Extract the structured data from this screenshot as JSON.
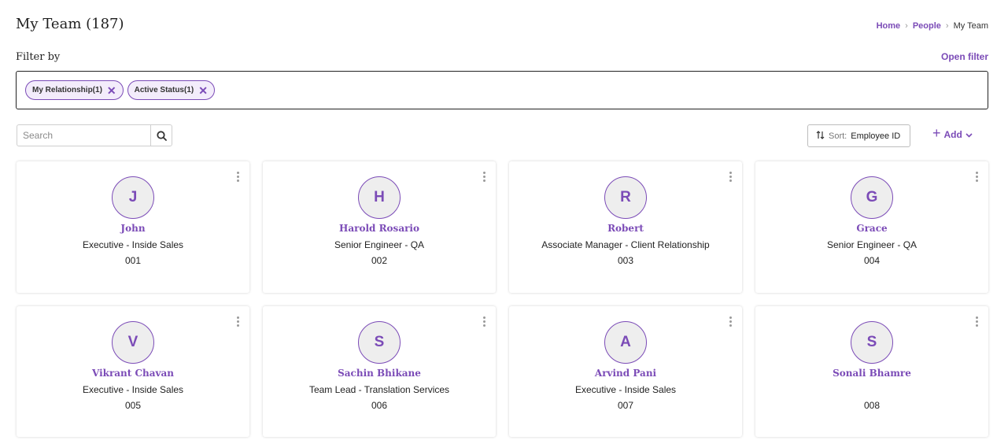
{
  "header": {
    "title": "My Team (187)",
    "breadcrumb": {
      "home": "Home",
      "people": "People",
      "current": "My Team"
    }
  },
  "filter": {
    "label": "Filter by",
    "open_label": "Open filter",
    "chips": [
      "My Relationship(1)",
      "Active Status(1)"
    ]
  },
  "search": {
    "placeholder": "Search"
  },
  "sort": {
    "label": "Sort:",
    "value": "Employee ID"
  },
  "add": {
    "label": "Add"
  },
  "colors": {
    "accent": "#7b4bb7",
    "avatar_bg": "#eeeeee"
  },
  "employees": [
    {
      "initial": "J",
      "name": "John",
      "role": "Executive - Inside Sales",
      "id": "001"
    },
    {
      "initial": "H",
      "name": "Harold Rosario",
      "role": "Senior Engineer - QA",
      "id": "002"
    },
    {
      "initial": "R",
      "name": "Robert",
      "role": "Associate Manager - Client Relationship",
      "id": "003"
    },
    {
      "initial": "G",
      "name": "Grace",
      "role": "Senior Engineer - QA",
      "id": "004"
    },
    {
      "initial": "V",
      "name": "Vikrant Chavan",
      "role": "Executive - Inside Sales",
      "id": "005"
    },
    {
      "initial": "S",
      "name": "Sachin Bhikane",
      "role": "Team Lead - Translation Services",
      "id": "006"
    },
    {
      "initial": "A",
      "name": "Arvind Pani",
      "role": "Executive - Inside Sales",
      "id": "007"
    },
    {
      "initial": "S",
      "name": "Sonali Bhamre",
      "role": "",
      "id": "008"
    }
  ]
}
